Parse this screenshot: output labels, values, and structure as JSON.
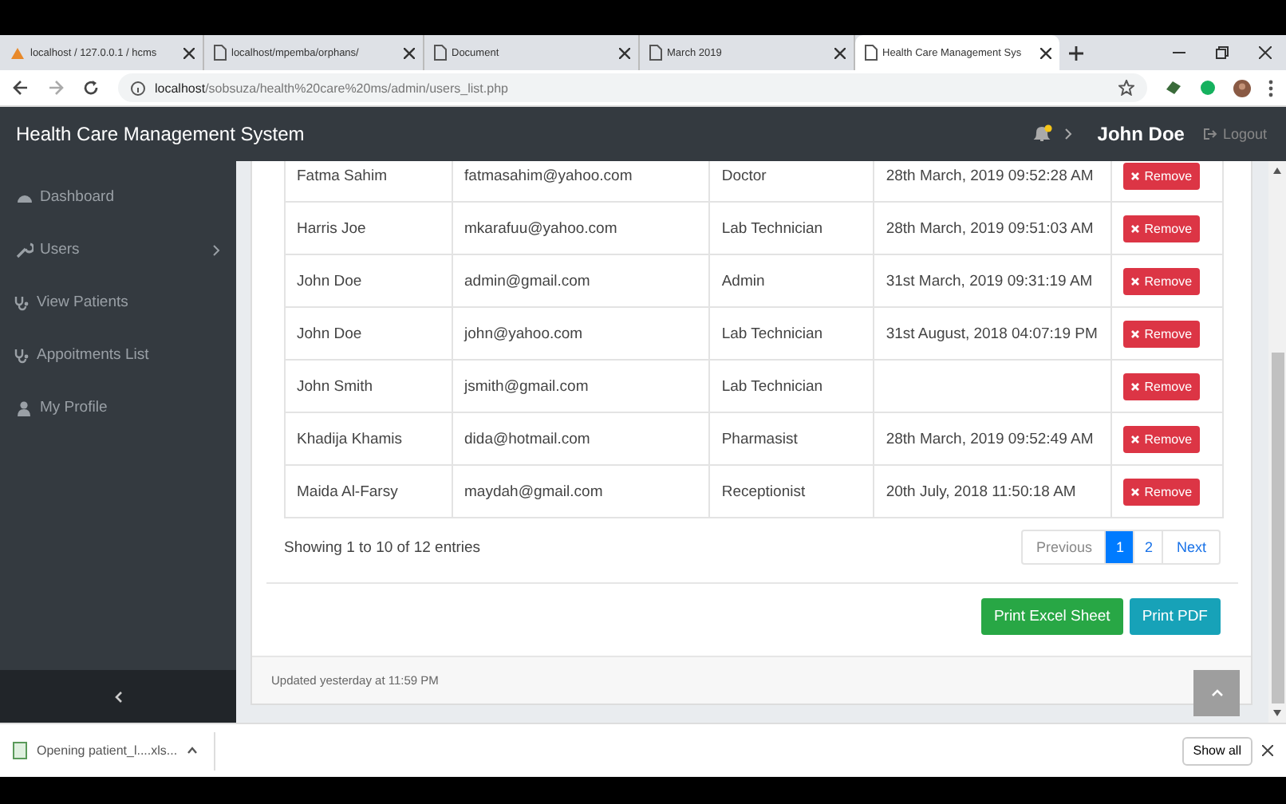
{
  "browser": {
    "tabs": [
      {
        "title": "localhost / 127.0.0.1 / hcms",
        "kind": "sail",
        "selected": false
      },
      {
        "title": "localhost/mpemba/orphans/",
        "kind": "page",
        "selected": false
      },
      {
        "title": "Document",
        "kind": "page",
        "selected": false
      },
      {
        "title": "March 2019",
        "kind": "page",
        "selected": false
      },
      {
        "title": "Health Care Management Sys",
        "kind": "page",
        "selected": true
      }
    ],
    "address": {
      "host": "localhost",
      "path": "/sobsuza/health%20care%20ms/admin/users_list.php"
    }
  },
  "app": {
    "title": "Health Care Management System",
    "user": "John Doe",
    "logout": "Logout",
    "notification": true
  },
  "sidebar": {
    "items": [
      {
        "label": "Dashboard",
        "kind": "gauge",
        "submenu": false
      },
      {
        "label": "Users",
        "kind": "wrench",
        "submenu": true
      },
      {
        "label": "View Patients",
        "kind": "stethoscope",
        "submenu": false
      },
      {
        "label": "Appoitments List",
        "kind": "stethoscope",
        "submenu": false
      },
      {
        "label": "My Profile",
        "kind": "user",
        "submenu": false
      }
    ]
  },
  "table": {
    "rows": [
      {
        "name": "Fatma Sahim",
        "email": "fatmasahim@yahoo.com",
        "role": "Doctor",
        "date": "28th March, 2019 09:52:28 AM",
        "action": "Remove"
      },
      {
        "name": "Harris Joe",
        "email": "mkarafuu@yahoo.com",
        "role": "Lab Technician",
        "date": "28th March, 2019 09:51:03 AM",
        "action": "Remove"
      },
      {
        "name": "John Doe",
        "email": "admin@gmail.com",
        "role": "Admin",
        "date": "31st March, 2019 09:31:19 AM",
        "action": "Remove"
      },
      {
        "name": "John Doe",
        "email": "john@yahoo.com",
        "role": "Lab Technician",
        "date": "31st August, 2018 04:07:19 PM",
        "action": "Remove"
      },
      {
        "name": "John Smith",
        "email": "jsmith@gmail.com",
        "role": "Lab Technician",
        "action": "Remove"
      },
      {
        "name": "Khadija Khamis",
        "email": "dida@hotmail.com",
        "role": "Pharmasist",
        "date": "28th March, 2019 09:52:49 AM",
        "action": "Remove"
      },
      {
        "name": "Maida Al-Farsy",
        "email": "maydah@gmail.com",
        "role": "Receptionist",
        "date": "20th July, 2018 11:50:18 AM",
        "action": "Remove"
      }
    ]
  },
  "pagination": {
    "info": "Showing 1 to 10 of 12 entries",
    "previous": "Previous",
    "pages": [
      {
        "label": "1",
        "selected": true
      },
      {
        "label": "2",
        "selected": false
      }
    ],
    "next": "Next"
  },
  "actions": [
    {
      "label": "Print Excel Sheet",
      "kind": "success"
    },
    {
      "label": "Print PDF",
      "kind": "info"
    }
  ],
  "footer": "Updated yesterday at 11:59 PM",
  "download_bar": {
    "file": "Opening patient_l....xls...",
    "button": "Show all"
  }
}
